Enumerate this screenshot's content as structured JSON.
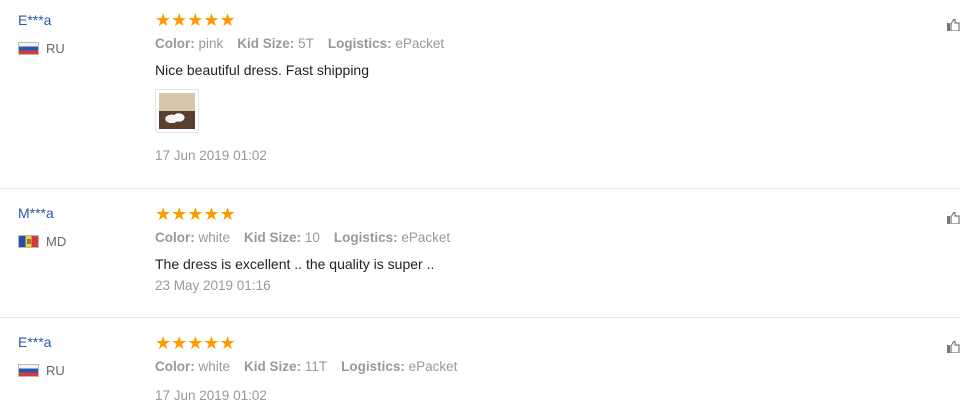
{
  "reviews": [
    {
      "user": "E***a",
      "country": "RU",
      "rating_stars": "★★★★★",
      "color_label": "Color:",
      "color": "pink",
      "size_label": "Kid Size:",
      "size": "5T",
      "logistics_label": "Logistics:",
      "logistics": "ePacket",
      "text": "Nice beautiful dress. Fast shipping",
      "date": "17 Jun 2019 01:02"
    },
    {
      "user": "M***a",
      "country": "MD",
      "rating_stars": "★★★★★",
      "color_label": "Color:",
      "color": "white",
      "size_label": "Kid Size:",
      "size": "10",
      "logistics_label": "Logistics:",
      "logistics": "ePacket",
      "text": "The dress is excellent .. the quality is super ..",
      "date": "23 May 2019 01:16"
    },
    {
      "user": "E***a",
      "country": "RU",
      "rating_stars": "★★★★★",
      "color_label": "Color:",
      "color": "white",
      "size_label": "Kid Size:",
      "size": "11T",
      "logistics_label": "Logistics:",
      "logistics": "ePacket",
      "date": "17 Jun 2019 01:02"
    }
  ],
  "colors": {
    "star": "#ff9a00",
    "username": "#2a5aa8",
    "meta": "#999999"
  },
  "icons": {
    "helpful": "thumbs-up-icon",
    "flag_ru": "russia-flag-icon",
    "flag_md": "moldova-flag-icon"
  }
}
